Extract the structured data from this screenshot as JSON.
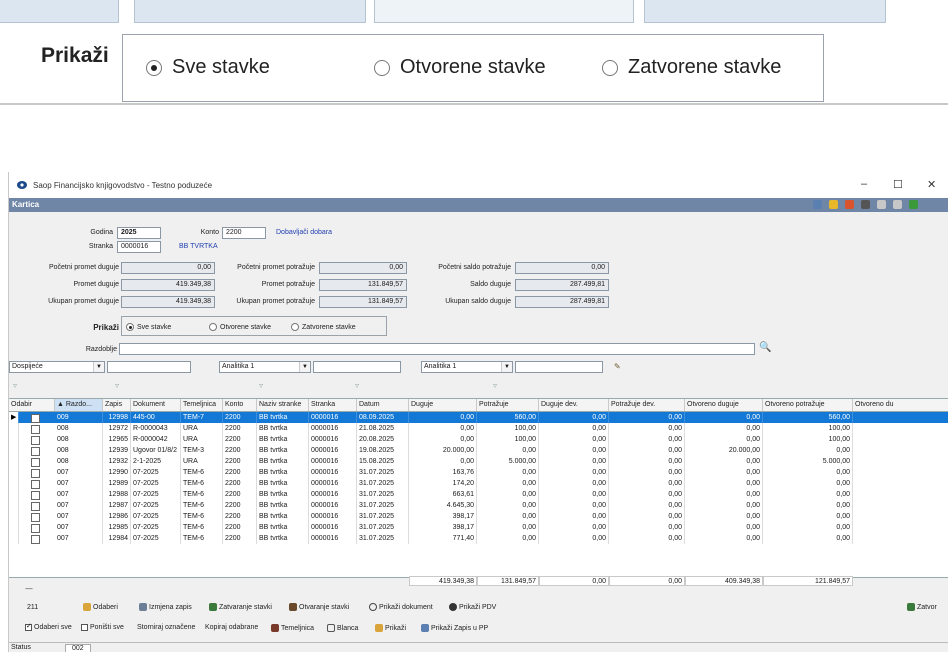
{
  "zoom": {
    "label": "Prikaži",
    "options": [
      {
        "label": "Sve stavke",
        "checked": true
      },
      {
        "label": "Otvorene stavke",
        "checked": false
      },
      {
        "label": "Zatvorene stavke",
        "checked": false
      }
    ]
  },
  "window": {
    "title": "Saop   Financijsko knjigovodstvo - Testno poduzeće",
    "controls": [
      "–",
      "☐",
      "✕"
    ],
    "form_title": "Kartica"
  },
  "header": {
    "godina_label": "Godina",
    "godina_value": "2025",
    "konto_label": "Konto",
    "konto_value": "2200",
    "konto_name": "Dobavljači dobara",
    "stranka_label": "Stranka",
    "stranka_value": "0000016",
    "stranka_name": "BB TVRTKA"
  },
  "totals_form": {
    "pp_duguje_label": "Početni promet duguje",
    "pp_duguje": "0,00",
    "pp_potrazuje_label": "Početni promet potražuje",
    "pp_potrazuje": "0,00",
    "ps_potrazuje_label": "Početni saldo potražuje",
    "ps_potrazuje": "0,00",
    "p_duguje_label": "Promet duguje",
    "p_duguje": "419.349,38",
    "p_potrazuje_label": "Promet potražuje",
    "p_potrazuje": "131.849,57",
    "saldo_duguje_label": "Saldo duguje",
    "saldo_duguje": "287.499,81",
    "u_duguje_label": "Ukupan promet duguje",
    "u_duguje": "419.349,38",
    "u_potrazuje_label": "Ukupan promet potražuje",
    "u_potrazuje": "131.849,57",
    "u_saldo_label": "Ukupan saldo duguje",
    "u_saldo": "287.499,81"
  },
  "filter": {
    "prikazi_label": "Prikaži",
    "options": [
      "Sve stavke",
      "Otvorene stavke",
      "Zatvorene stavke"
    ],
    "razdoblje_label": "Razdoblje",
    "dospijece": "Dospijeće",
    "analitika1": "Analitika 1",
    "analitika2": "Analitika 1"
  },
  "grid": {
    "columns": [
      "Odabir",
      "▲ Razdo...",
      "Zapis",
      "Dokument",
      "Temeljnica",
      "Konto",
      "Naziv stranke",
      "Stranka",
      "Datum",
      "Duguje",
      "Potražuje",
      "Duguje dev.",
      "Potražuje dev.",
      "Otvoreno duguje",
      "Otvoreno potražuje",
      "Otvoreno du"
    ],
    "rows": [
      [
        "009",
        "12998",
        "445-00",
        "TEM-7",
        "2200",
        "BB tvrtka",
        "0000016",
        "08.09.2025",
        "0,00",
        "560,00",
        "0,00",
        "0,00",
        "0,00",
        "560,00"
      ],
      [
        "008",
        "12972",
        "R-0000043",
        "URA",
        "2200",
        "BB tvrtka",
        "0000016",
        "21.08.2025",
        "0,00",
        "100,00",
        "0,00",
        "0,00",
        "0,00",
        "100,00"
      ],
      [
        "008",
        "12965",
        "R-0000042",
        "URA",
        "2200",
        "BB tvrtka",
        "0000016",
        "20.08.2025",
        "0,00",
        "100,00",
        "0,00",
        "0,00",
        "0,00",
        "100,00"
      ],
      [
        "008",
        "12939",
        "Ugovor 01/8/2",
        "TEM-3",
        "2200",
        "BB tvrtka",
        "0000016",
        "19.08.2025",
        "20.000,00",
        "0,00",
        "0,00",
        "0,00",
        "20.000,00",
        "0,00"
      ],
      [
        "008",
        "12932",
        "2-1-2025",
        "URA",
        "2200",
        "BB tvrtka",
        "0000016",
        "15.08.2025",
        "0,00",
        "5.000,00",
        "0,00",
        "0,00",
        "0,00",
        "5.000,00"
      ],
      [
        "007",
        "12990",
        "07-2025",
        "TEM-6",
        "2200",
        "BB tvrtka",
        "0000016",
        "31.07.2025",
        "163,76",
        "0,00",
        "0,00",
        "0,00",
        "0,00",
        "0,00"
      ],
      [
        "007",
        "12989",
        "07-2025",
        "TEM-6",
        "2200",
        "BB tvrtka",
        "0000016",
        "31.07.2025",
        "174,20",
        "0,00",
        "0,00",
        "0,00",
        "0,00",
        "0,00"
      ],
      [
        "007",
        "12988",
        "07-2025",
        "TEM-6",
        "2200",
        "BB tvrtka",
        "0000016",
        "31.07.2025",
        "663,61",
        "0,00",
        "0,00",
        "0,00",
        "0,00",
        "0,00"
      ],
      [
        "007",
        "12987",
        "07-2025",
        "TEM-6",
        "2200",
        "BB tvrtka",
        "0000016",
        "31.07.2025",
        "4.645,30",
        "0,00",
        "0,00",
        "0,00",
        "0,00",
        "0,00"
      ],
      [
        "007",
        "12986",
        "07-2025",
        "TEM-6",
        "2200",
        "BB tvrtka",
        "0000016",
        "31.07.2025",
        "398,17",
        "0,00",
        "0,00",
        "0,00",
        "0,00",
        "0,00"
      ],
      [
        "007",
        "12985",
        "07-2025",
        "TEM-6",
        "2200",
        "BB tvrtka",
        "0000016",
        "31.07.2025",
        "398,17",
        "0,00",
        "0,00",
        "0,00",
        "0,00",
        "0,00"
      ],
      [
        "007",
        "12984",
        "07-2025",
        "TEM-6",
        "2200",
        "BB tvrtka",
        "0000016",
        "31.07.2025",
        "771,40",
        "0,00",
        "0,00",
        "0,00",
        "0,00",
        "0,00"
      ]
    ],
    "totals": [
      "419.349,38",
      "131.849,57",
      "0,00",
      "0,00",
      "409.349,38",
      "121.849,57"
    ]
  },
  "footer": {
    "count": "211",
    "status_label": "Status",
    "status_value": "002",
    "actions1": [
      "Odaberi",
      "Izmjena zapis",
      "Zatvaranje stavki",
      "Otvaranje stavki",
      "Prikaži dokument",
      "Prikaži PDV"
    ],
    "close_label": "Zatvor",
    "odaberi_sve": "Odaberi sve",
    "ponisti_sve": "Poništi sve",
    "actions2": [
      "Storniraj označene",
      "Kopiraj odabrane",
      "Temeljnica",
      "Blanca",
      "Prikaži",
      "Prikaži Zapis u PP"
    ]
  },
  "colors": {
    "title_bar": "#6f86a6",
    "selection": "#1479d6",
    "link": "#1f3fb0"
  }
}
